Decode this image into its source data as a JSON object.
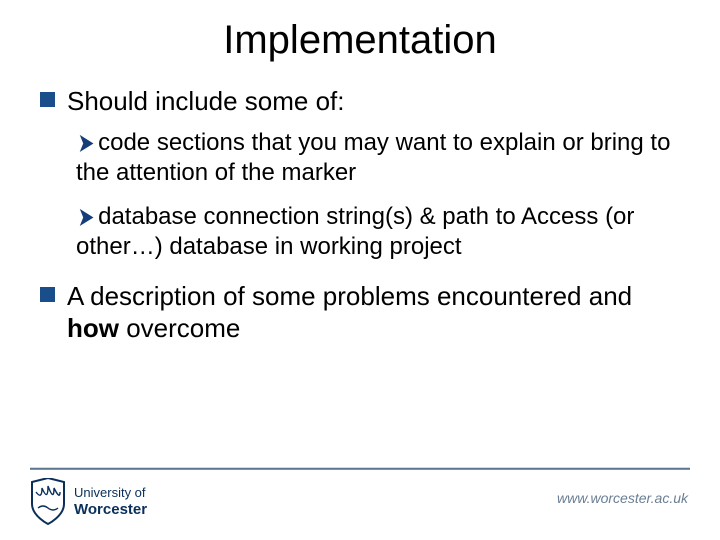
{
  "title": "Implementation",
  "bullets": [
    {
      "text": "Should include some of:",
      "sub": [
        "code sections that you may want to explain or bring to the attention of the marker",
        "database connection string(s) & path to Access (or other…) database in working project"
      ]
    },
    {
      "html": "A description of some problems encountered and <b>how</b> overcome",
      "sub": []
    }
  ],
  "footer": {
    "uni_line1": "University of",
    "uni_line2": "Worcester",
    "url": "www.worcester.ac.uk"
  }
}
